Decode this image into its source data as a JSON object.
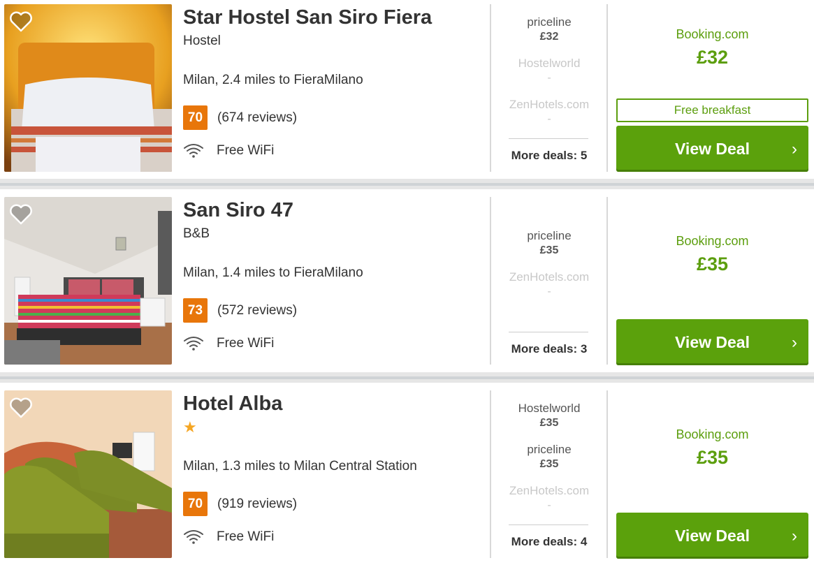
{
  "colors": {
    "accent_green": "#5c9e0e",
    "rating_orange": "#e8760a",
    "button_green": "#5ba10c"
  },
  "listings": [
    {
      "name": "Star Hostel San Siro Fiera",
      "type": "Hostel",
      "stars": "",
      "location": "Milan, 2.4 miles to FieraMilano",
      "rating": "70",
      "reviews": "(674 reviews)",
      "amenity": "Free WiFi",
      "providers": [
        {
          "name": "priceline",
          "price": "£32",
          "available": true
        },
        {
          "name": "Hostelworld",
          "price": "-",
          "available": false
        },
        {
          "name": "ZenHotels.com",
          "price": "-",
          "available": false
        }
      ],
      "more_deals": "More deals: 5",
      "best_provider": "Booking.com",
      "best_price": "£32",
      "perk": "Free breakfast",
      "cta": "View Deal"
    },
    {
      "name": "San Siro 47",
      "type": "B&B",
      "stars": "",
      "location": "Milan, 1.4 miles to FieraMilano",
      "rating": "73",
      "reviews": "(572 reviews)",
      "amenity": "Free WiFi",
      "providers": [
        {
          "name": "priceline",
          "price": "£35",
          "available": true
        },
        {
          "name": "ZenHotels.com",
          "price": "-",
          "available": false
        }
      ],
      "more_deals": "More deals: 3",
      "best_provider": "Booking.com",
      "best_price": "£35",
      "cta": "View Deal"
    },
    {
      "name": "Hotel Alba",
      "type": "",
      "stars": "★",
      "location": "Milan, 1.3 miles to Milan Central Station",
      "rating": "70",
      "reviews": "(919 reviews)",
      "amenity": "Free WiFi",
      "providers": [
        {
          "name": "Hostelworld",
          "price": "£35",
          "available": true
        },
        {
          "name": "priceline",
          "price": "£35",
          "available": true
        },
        {
          "name": "ZenHotels.com",
          "price": "-",
          "available": false
        }
      ],
      "more_deals": "More deals: 4",
      "best_provider": "Booking.com",
      "best_price": "£35",
      "cta": "View Deal"
    }
  ]
}
